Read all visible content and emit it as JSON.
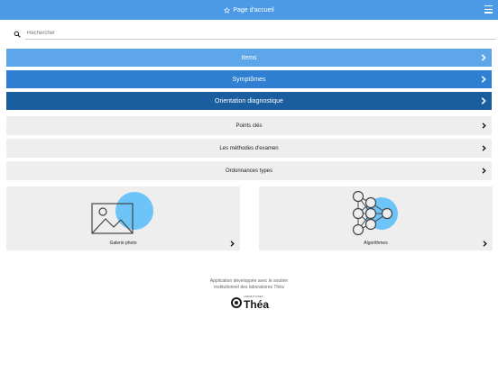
{
  "header": {
    "title": "Page d'accueil",
    "star_icon": "star-icon",
    "menu_icon": "hamburger-menu-icon",
    "color": "#4c9ae6"
  },
  "search": {
    "placeholder": "Rechercher",
    "icon": "search-icon"
  },
  "main_bars": [
    {
      "label": "Items",
      "color": "#5ea6ea"
    },
    {
      "label": "Symptômes",
      "color": "#2f7fd2"
    },
    {
      "label": "Orientation diagnostique",
      "color": "#1a5e9f"
    }
  ],
  "secondary": [
    {
      "label": "Points clés"
    },
    {
      "label": "Les méthodes d'examen"
    },
    {
      "label": "Ordonnances types"
    }
  ],
  "tiles": [
    {
      "label": "Galerie photo",
      "icon": "photo-gallery-icon"
    },
    {
      "label": "Algorithmes",
      "icon": "algorithm-network-icon"
    }
  ],
  "footer": {
    "line1": "Application développée avec le soutien",
    "line2": "institutionnel des laboratoires Théa",
    "logo_small": "LABORATOIRES",
    "logo_brand": "Théa"
  },
  "colors": {
    "accent_circle": "#6cc4f9"
  }
}
